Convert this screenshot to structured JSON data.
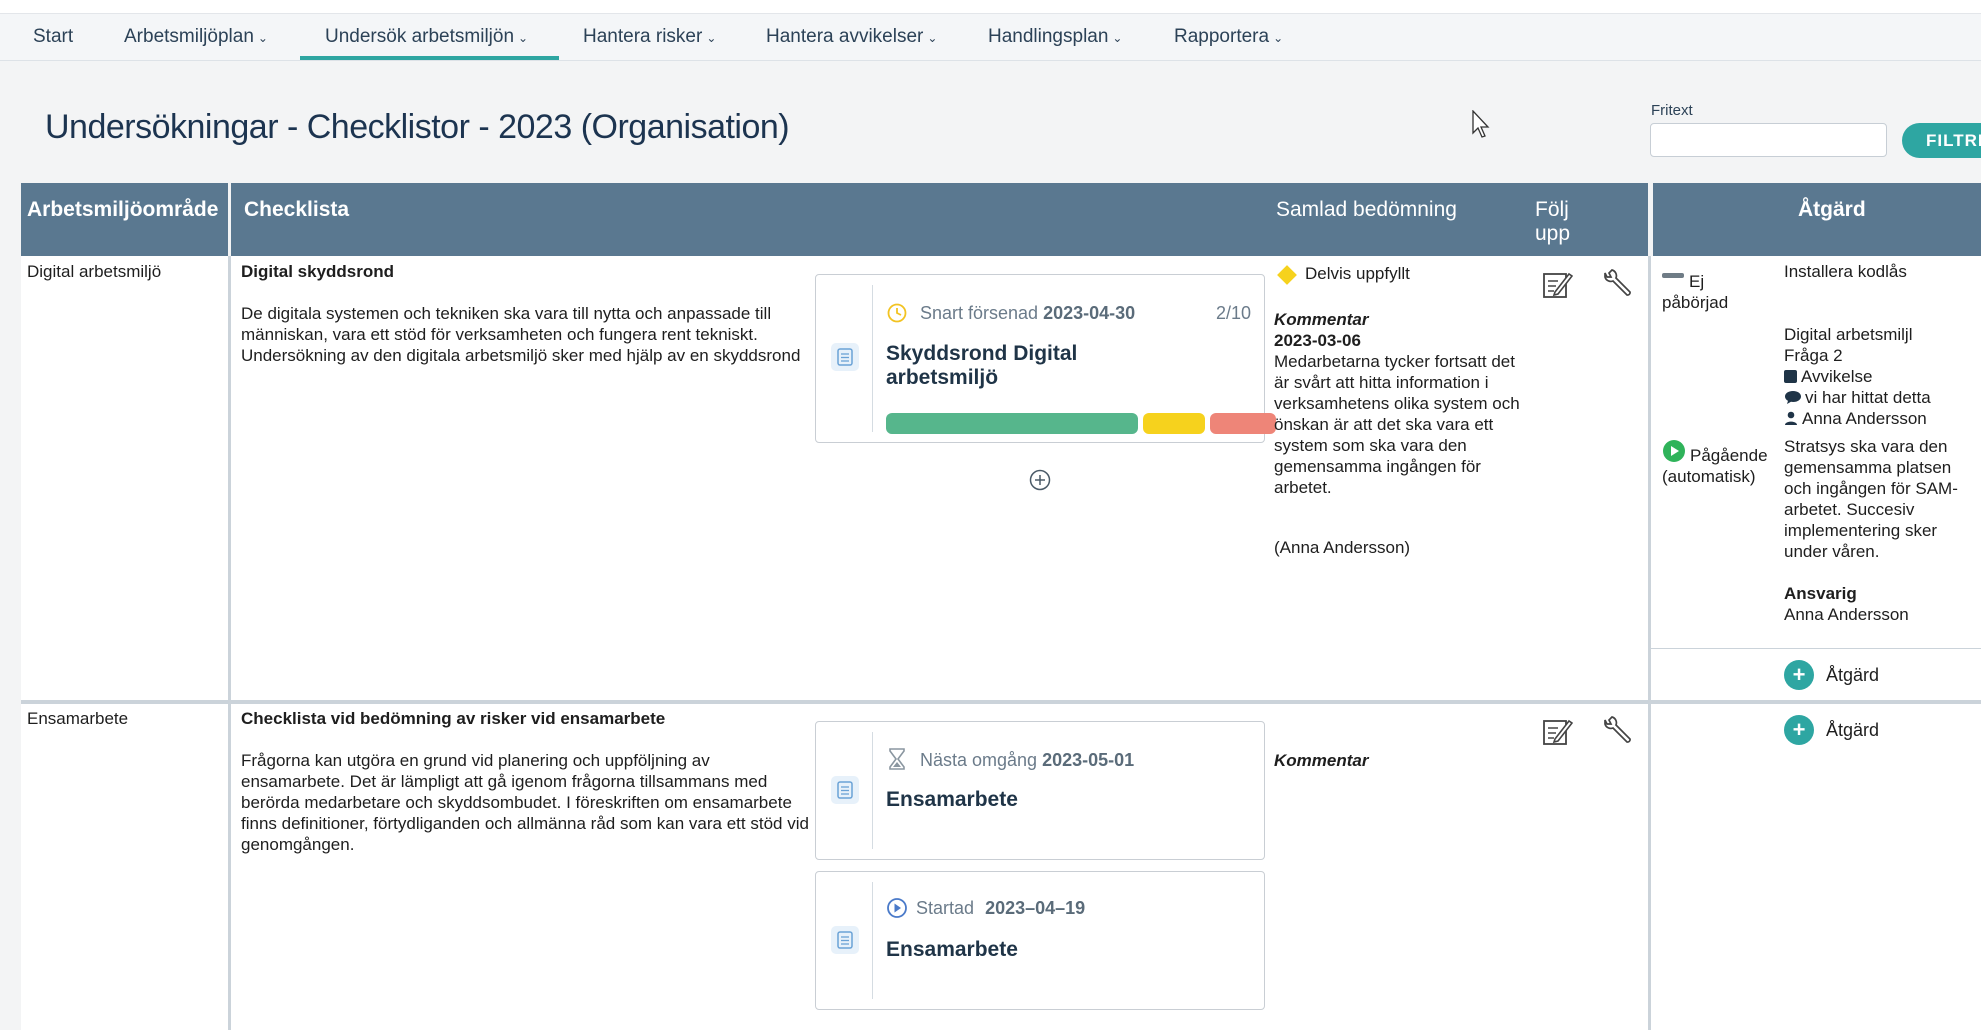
{
  "nav": {
    "items": [
      {
        "label": "Start",
        "chevron": false
      },
      {
        "label": "Arbetsmiljöplan",
        "chevron": true
      },
      {
        "label": "Undersök arbetsmiljön",
        "chevron": true,
        "active": true
      },
      {
        "label": "Hantera risker",
        "chevron": true
      },
      {
        "label": "Hantera avvikelser",
        "chevron": true
      },
      {
        "label": "Handlingsplan",
        "chevron": true
      },
      {
        "label": "Rapportera",
        "chevron": true
      }
    ]
  },
  "page": {
    "title": "Undersökningar - Checklistor - 2023 (Organisation)",
    "fritext_label": "Fritext",
    "fritext_value": "",
    "filter_button": "FILTRE"
  },
  "table": {
    "headers": {
      "area": "Arbetsmiljöområde",
      "checklist": "Checklista",
      "assessment": "Samlad bedömning",
      "follow_up": "Följ upp",
      "action": "Åtgärd"
    },
    "rows": [
      {
        "area": "Digital arbetsmiljö",
        "checklist_title": "Digital skyddsrond",
        "checklist_description": "De digitala systemen och tekniken ska vara till nytta och anpassade till människan, vara ett stöd för verksamheten och fungera rent tekniskt. Undersökning av den digitala arbetsmiljö sker med hjälp av en skyddsrond",
        "card": {
          "status": "Snart försenad",
          "date": "2023-04-30",
          "count": "2/10",
          "title": "Skyddsrond Digital arbetsmiljö",
          "progress": {
            "green": 0.53,
            "yellow": 0.13,
            "red": 0.14
          }
        },
        "assessment": {
          "label": "Delvis uppfyllt",
          "comment_label": "Kommentar",
          "comment_date": "2023-03-06",
          "comment_text": "Medarbetarna tycker fortsatt det är svårt att hitta information i verksamhetens olika system och önskan är att det ska vara ett system som ska vara den gemensamma ingången för arbetet.",
          "comment_author": "(Anna Andersson)"
        },
        "actions": [
          {
            "status": "Ej påbörjad",
            "title": "Installera kodlås",
            "link_title": "Digital arbetsmiljl",
            "link_sub": "Fråga 2",
            "deviation": "Avvikelse",
            "comment": "vi har hittat detta",
            "person": "Anna Andersson"
          },
          {
            "status": "Pågående (automatisk)",
            "text": "Stratsys ska vara den gemensamma platsen och ingången för SAM-arbetet. Succesiv implementering sker under våren.",
            "responsible_label": "Ansvarig",
            "responsible": "Anna Andersson"
          }
        ],
        "add_action": "Åtgärd"
      },
      {
        "area": "Ensamarbete",
        "checklist_title": "Checklista vid bedömning av risker vid ensamarbete",
        "checklist_description": "Frågorna kan utgöra en grund vid planering och uppföljning av ensamarbete. Det är lämpligt att gå igenom frågorna tillsammans med berörda medarbetare och skyddsombudet. I föreskriften om ensamarbete finns definitioner, förtydliganden och allmänna råd som kan vara ett stöd vid genomgången.",
        "cards": [
          {
            "status": "Nästa omgång",
            "date": "2023-05-01",
            "title": "Ensamarbete"
          },
          {
            "status": "Startad",
            "date": "2023–04–19",
            "title": "Ensamarbete"
          }
        ],
        "assessment": {
          "comment_label": "Kommentar"
        },
        "add_action": "Åtgärd"
      }
    ]
  },
  "colors": {
    "header_bg": "#5a7890",
    "accent": "#2ea6a2",
    "title": "#1c3450",
    "progress_green": "#56b68c",
    "progress_yellow": "#f6d21d",
    "progress_red": "#ee8578"
  }
}
